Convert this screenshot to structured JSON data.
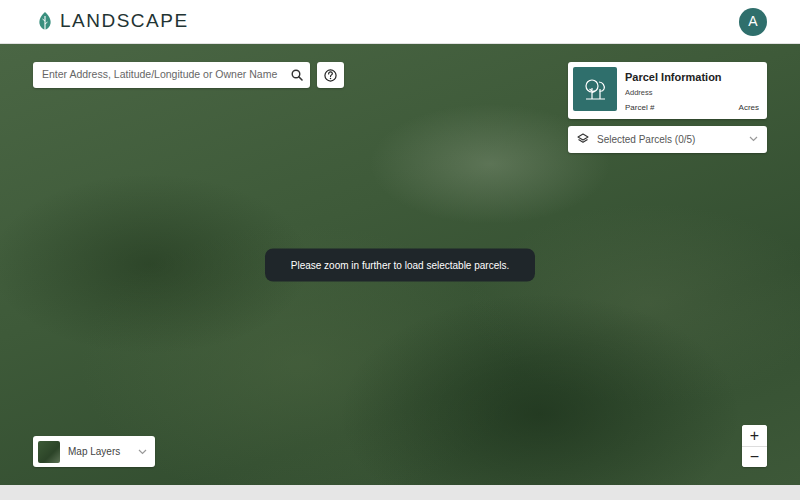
{
  "header": {
    "logo": "LANDSCAPE",
    "avatar": "A"
  },
  "search": {
    "placeholder": "Enter Address, Latitude/Longitude or Owner Name"
  },
  "parcel_info": {
    "title": "Parcel Information",
    "address": "Address",
    "parcel": "Parcel #",
    "acres": "Acres"
  },
  "selected_parcels": {
    "label": "Selected Parcels (0/5)",
    "expanded": false
  },
  "toast": "Please zoom in further to load selectable parcels.",
  "map_layers": {
    "label": "Map Layers",
    "expanded": false
  },
  "zoom": {
    "in": "+",
    "out": "−"
  }
}
